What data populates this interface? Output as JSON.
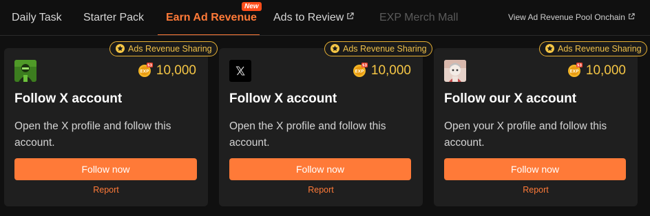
{
  "tabs": [
    {
      "label": "Daily Task",
      "state": "normal"
    },
    {
      "label": "Starter Pack",
      "state": "normal"
    },
    {
      "label": "Earn Ad Revenue",
      "state": "active",
      "badge": "New"
    },
    {
      "label": "Ads to Review",
      "state": "normal",
      "external": true
    },
    {
      "label": "EXP Merch Mall",
      "state": "disabled"
    }
  ],
  "pool_link": {
    "label": "View Ad Revenue Pool Onchain",
    "external": true
  },
  "colors": {
    "accent": "#ff7a38",
    "gold": "#f5c645",
    "badge_border": "#e9b234",
    "card_bg": "#1f1f1f",
    "page_bg": "#101010"
  },
  "cards": [
    {
      "badge": "Ads Revenue Sharing",
      "avatar_icon": "green-character-avatar",
      "coin_icon": "exp-coin-icon",
      "coin_badge": "S3",
      "reward": "10,000",
      "title": "Follow X account",
      "description": "Open the X profile and follow this account.",
      "button": "Follow now",
      "report": "Report"
    },
    {
      "badge": "Ads Revenue Sharing",
      "avatar_icon": "x-logo-avatar",
      "coin_icon": "exp-coin-icon",
      "coin_badge": "S3",
      "reward": "10,000",
      "title": "Follow X account",
      "description": "Open the X profile and follow this account.",
      "button": "Follow now",
      "report": "Report"
    },
    {
      "badge": "Ads Revenue Sharing",
      "avatar_icon": "anime-character-avatar",
      "coin_icon": "exp-coin-icon",
      "coin_badge": "S3",
      "reward": "10,000",
      "title": "Follow our X account",
      "description": "Open your X profile and follow this account.",
      "button": "Follow now",
      "report": "Report"
    }
  ]
}
